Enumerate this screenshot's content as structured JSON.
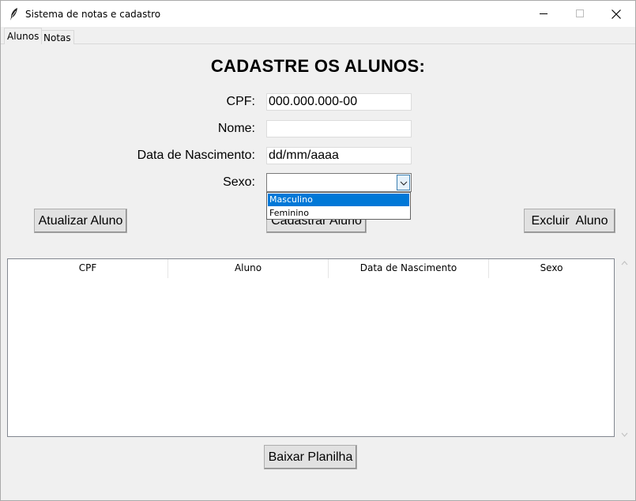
{
  "window": {
    "title": "Sistema de notas e cadastro"
  },
  "tabs": [
    {
      "label": "Alunos",
      "active": true
    },
    {
      "label": "Notas",
      "active": false
    }
  ],
  "form": {
    "title": "CADASTRE OS ALUNOS:",
    "cpf": {
      "label": "CPF:",
      "value": "000.000.000-00"
    },
    "nome": {
      "label": "Nome:",
      "value": ""
    },
    "data": {
      "label": "Data de Nascimento:",
      "value": "dd/mm/aaaa"
    },
    "sexo": {
      "label": "Sexo:",
      "value": "",
      "options": [
        "Masculino",
        "Feminino"
      ],
      "highlighted": "Masculino"
    }
  },
  "buttons": {
    "atualizar": "Atualizar Aluno",
    "cadastrar": "Cadastrar Aluno",
    "excluir": "Excluir  Aluno",
    "baixar": "Baixar Planilha"
  },
  "table": {
    "columns": [
      "CPF",
      "Aluno",
      "Data de Nascimento",
      "Sexo"
    ],
    "rows": []
  },
  "icons": {
    "app": "feather-icon",
    "minimize": "minimize-icon",
    "maximize": "maximize-icon",
    "close": "close-icon",
    "combo": "chevron-down-icon",
    "scroll_up": "scroll-up-icon",
    "scroll_down": "scroll-down-icon"
  },
  "colors": {
    "selection": "#0078d7",
    "window_bg": "#f0f0f0",
    "button_bg": "#e1e1e1"
  }
}
